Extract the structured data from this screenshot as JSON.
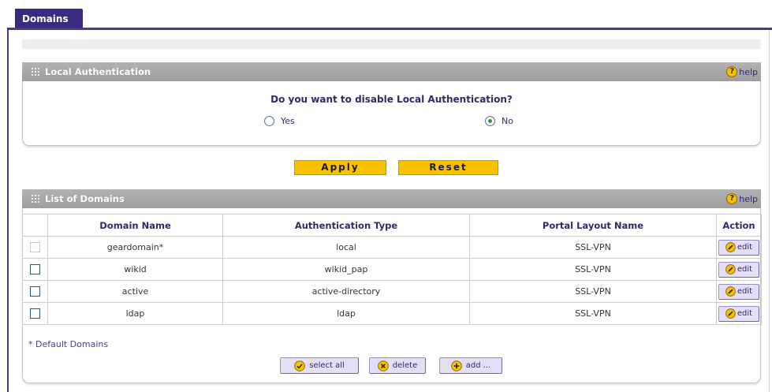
{
  "theme": {
    "accent": "#4a3891",
    "tab_bg": "#3b2b80",
    "header_bg": "#a6a6a6",
    "button_yellow": "#f7c100",
    "text_navy": "#2d2a6e",
    "button_lavender": "#e4dff7"
  },
  "tab": {
    "label": "Domains"
  },
  "local_auth": {
    "title": "Local Authentication",
    "help_label": "help",
    "question": "Do you want to disable Local Authentication?",
    "options": [
      {
        "label": "Yes",
        "selected": false
      },
      {
        "label": "No",
        "selected": true
      }
    ]
  },
  "form_actions": {
    "apply_label": "Apply",
    "reset_label": "Reset"
  },
  "domains": {
    "title": "List of Domains",
    "help_label": "help",
    "columns": [
      "Domain Name",
      "Authentication Type",
      "Portal Layout Name",
      "Action"
    ],
    "rows": [
      {
        "name": "geardomain*",
        "auth_type": "local",
        "portal_layout": "SSL-VPN",
        "action_label": "edit",
        "checkbox_disabled": true
      },
      {
        "name": "wikid",
        "auth_type": "wikid_pap",
        "portal_layout": "SSL-VPN",
        "action_label": "edit",
        "checkbox_disabled": false
      },
      {
        "name": "active",
        "auth_type": "active-directory",
        "portal_layout": "SSL-VPN",
        "action_label": "edit",
        "checkbox_disabled": false
      },
      {
        "name": "ldap",
        "auth_type": "ldap",
        "portal_layout": "SSL-VPN",
        "action_label": "edit",
        "checkbox_disabled": false
      }
    ],
    "footnote": "* Default Domains",
    "buttons": {
      "select_all_label": "select all",
      "delete_label": "delete",
      "add_label": "add ..."
    }
  },
  "icons": {
    "section_header": "grid-icon",
    "help": "help-icon",
    "edit": "edit-icon",
    "select_all": "check-circle-icon",
    "delete": "cross-circle-icon",
    "add": "plus-circle-icon"
  }
}
